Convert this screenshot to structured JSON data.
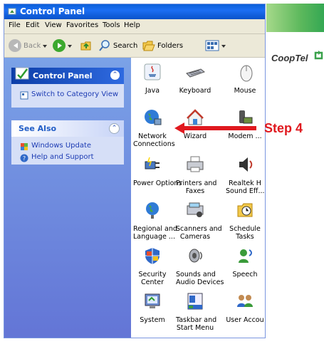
{
  "window": {
    "title": "Control Panel"
  },
  "menu": [
    "File",
    "Edit",
    "View",
    "Favorites",
    "Tools",
    "Help"
  ],
  "toolbar": {
    "back": "Back",
    "search": "Search",
    "folders": "Folders"
  },
  "sidebar": {
    "control_panel": {
      "title": "Control Panel",
      "switch_view": "Switch to Category View"
    },
    "see_also": {
      "title": "See Also",
      "items": [
        "Windows Update",
        "Help and Support"
      ]
    }
  },
  "items": [
    [
      "Java",
      "Keyboard",
      "Mouse"
    ],
    [
      "Network\nConnections",
      "Wizard",
      "Modem ..."
    ],
    [
      "Power Options",
      "Printers and\nFaxes",
      "Realtek H\nSound Eff..."
    ],
    [
      "Regional and\nLanguage ...",
      "Scanners and\nCameras",
      "Schedule\nTasks"
    ],
    [
      "Security\nCenter",
      "Sounds and\nAudio Devices",
      "Speech"
    ],
    [
      "System",
      "Taskbar and\nStart Menu",
      "User Accou"
    ]
  ],
  "annotation": {
    "label": "Step 4",
    "color": "#e0191f"
  },
  "brand": {
    "name": "CoopTel"
  }
}
